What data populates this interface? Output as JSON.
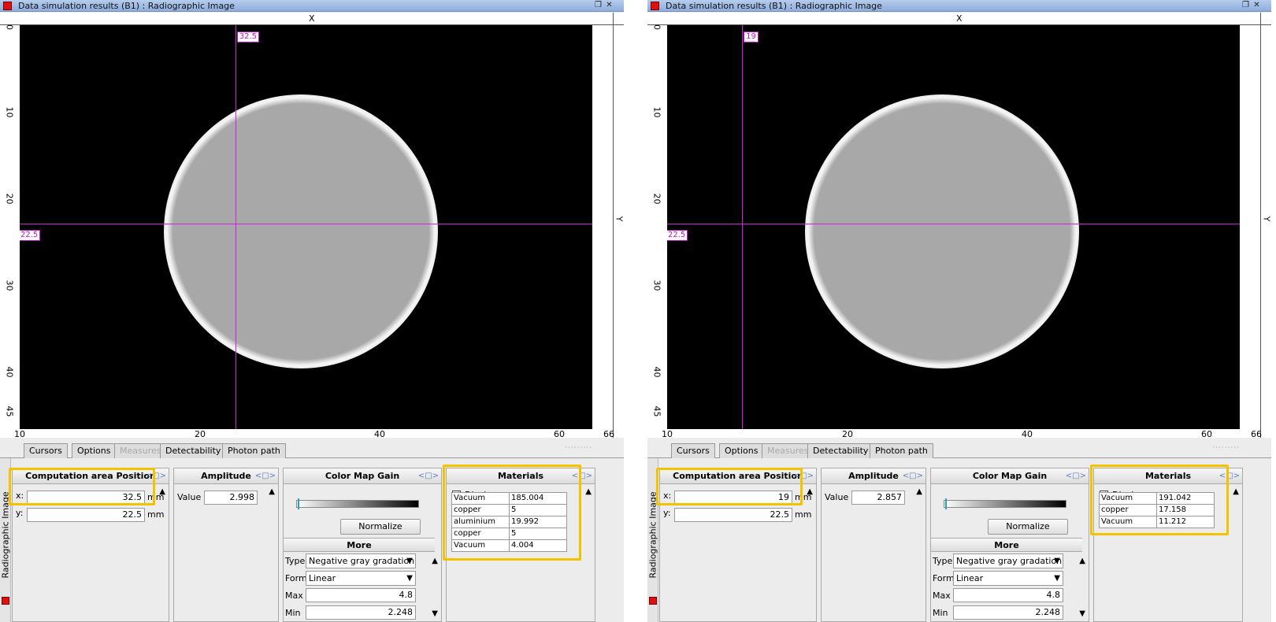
{
  "windows": [
    {
      "id": "left",
      "title": "Data simulation results (B1) : Radiographic Image",
      "axis": {
        "x_name": "X",
        "y_name": "Y",
        "x_ticks": [
          "10",
          "20",
          "40",
          "60",
          "66"
        ],
        "y_ticks": [
          "0",
          "10",
          "20",
          "30",
          "40",
          "45"
        ]
      },
      "cursor": {
        "x_label": "32.5",
        "y_label": "22.5"
      },
      "tabs": [
        "Cursors",
        "Options",
        "Measures",
        "Detectability",
        "Photon path"
      ],
      "side_label": "Radiographic Image",
      "computation": {
        "title": "Computation area Position",
        "x_label": "x:",
        "x_value": "32.5",
        "y_label": "y:",
        "y_value": "22.5",
        "unit": "mm"
      },
      "amplitude": {
        "title": "Amplitude",
        "label": "Value :",
        "value": "2.998"
      },
      "color_map": {
        "title": "Color Map Gain",
        "normalize_label": "Normalize",
        "more_label": "More",
        "type_label": "Type",
        "type_value": "Negative gray gradation",
        "form_label": "Form",
        "form_value": "Linear",
        "max_label": "Max",
        "max_value": "4.8",
        "min_label": "Min",
        "min_value": "2.248"
      },
      "materials": {
        "title": "Materials",
        "display_label": "Display",
        "display_checked": true,
        "rows": [
          {
            "name": "Vacuum",
            "value": "185.004"
          },
          {
            "name": "copper",
            "value": "5"
          },
          {
            "name": "aluminium",
            "value": "19.992"
          },
          {
            "name": "copper",
            "value": "5"
          },
          {
            "name": "Vacuum",
            "value": "4.004"
          }
        ]
      }
    },
    {
      "id": "right",
      "title": "Data simulation results (B1) : Radiographic Image",
      "axis": {
        "x_name": "X",
        "y_name": "Y",
        "x_ticks": [
          "10",
          "20",
          "40",
          "60",
          "66"
        ],
        "y_ticks": [
          "0",
          "10",
          "20",
          "30",
          "40",
          "45"
        ]
      },
      "cursor": {
        "x_label": "19",
        "y_label": "22.5"
      },
      "tabs": [
        "Cursors",
        "Options",
        "Measures",
        "Detectability",
        "Photon path"
      ],
      "side_label": "Radiographic Image",
      "computation": {
        "title": "Computation area Position",
        "x_label": "x:",
        "x_value": "19",
        "y_label": "y:",
        "y_value": "22.5",
        "unit": "mm"
      },
      "amplitude": {
        "title": "Amplitude",
        "label": "Value :",
        "value": "2.857"
      },
      "color_map": {
        "title": "Color Map Gain",
        "normalize_label": "Normalize",
        "more_label": "More",
        "type_label": "Type",
        "type_value": "Negative gray gradation",
        "form_label": "Form",
        "form_value": "Linear",
        "max_label": "Max",
        "max_value": "4.8",
        "min_label": "Min",
        "min_value": "2.248"
      },
      "materials": {
        "title": "Materials",
        "display_label": "Display",
        "display_checked": true,
        "rows": [
          {
            "name": "Vacuum",
            "value": "191.042"
          },
          {
            "name": "copper",
            "value": "17.158"
          },
          {
            "name": "Vacuum",
            "value": "11.212"
          }
        ]
      }
    }
  ],
  "colors": {
    "cursor": "#d020e0",
    "highlight": "#f5c200",
    "title_icon": "#e01010"
  },
  "icons": [
    "restore-icon",
    "close-icon",
    "pane-collapse-icon",
    "scroll-up-icon",
    "scroll-down-icon",
    "dropdown-arrow-icon",
    "checkbox-check-icon"
  ]
}
